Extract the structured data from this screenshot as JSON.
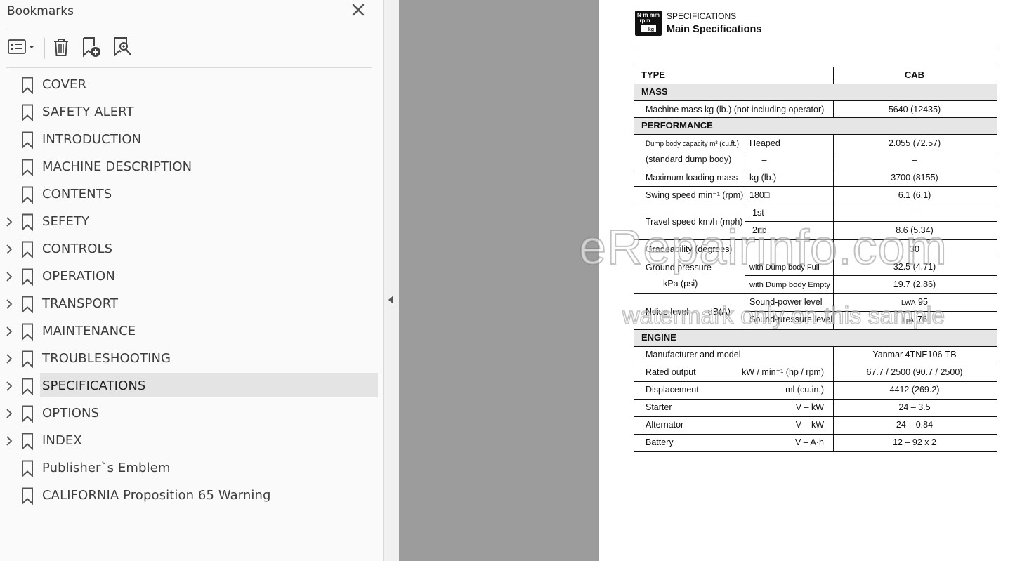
{
  "panel": {
    "title": "Bookmarks",
    "close_icon": "close-icon",
    "toolbar": [
      {
        "name": "options-menu-button",
        "icon": "list-options-icon"
      },
      {
        "name": "delete-bookmark-button",
        "icon": "trash-icon"
      },
      {
        "name": "new-bookmark-button",
        "icon": "bookmark-add-icon"
      },
      {
        "name": "find-bookmark-button",
        "icon": "bookmark-search-icon"
      }
    ],
    "bookmarks": [
      {
        "label": "COVER",
        "expandable": false
      },
      {
        "label": "SAFETY ALERT",
        "expandable": false
      },
      {
        "label": "INTRODUCTION",
        "expandable": false
      },
      {
        "label": "MACHINE DESCRIPTION",
        "expandable": false
      },
      {
        "label": "CONTENTS",
        "expandable": false
      },
      {
        "label": "SEFETY",
        "expandable": true
      },
      {
        "label": "CONTROLS",
        "expandable": true
      },
      {
        "label": "OPERATION",
        "expandable": true
      },
      {
        "label": "TRANSPORT",
        "expandable": true
      },
      {
        "label": "MAINTENANCE",
        "expandable": true
      },
      {
        "label": "TROUBLESHOOTING",
        "expandable": true
      },
      {
        "label": "SPECIFICATIONS",
        "expandable": true,
        "selected": true
      },
      {
        "label": "OPTIONS",
        "expandable": true
      },
      {
        "label": "INDEX",
        "expandable": true
      },
      {
        "label": "Publisher`s Emblem",
        "expandable": false
      },
      {
        "label": "CALIFORNIA Proposition 65 Warning",
        "expandable": false
      }
    ]
  },
  "doc": {
    "icon_text": {
      "line1": "N·m mm",
      "line2": "rpm",
      "line3": "kg"
    },
    "section_label": "SPECIFICATIONS",
    "section_title": "Main Specifications",
    "table": {
      "type_label": "TYPE",
      "type_value": "CAB",
      "mass_header": "MASS",
      "machine_mass_label": "Machine mass  kg (lb.) (not including operator)",
      "machine_mass_value": "5640 (12435)",
      "performance_header": "PERFORMANCE",
      "dump_label_1": "Dump body capacity m³ (cu.ft.)",
      "dump_label_2": "(standard dump body)",
      "dump_sub_1": "Heaped",
      "dump_val_1": "2.055 (72.57)",
      "dump_sub_2": "–",
      "dump_val_2": "–",
      "max_load_label": "Maximum loading mass",
      "max_load_unit": "kg (lb.)",
      "max_load_value": "3700 (8155)",
      "swing_label": "Swing speed  min⁻¹ (rpm)",
      "swing_sub": "180□",
      "swing_value": "6.1 (6.1)",
      "travel_label": "Travel speed km/h (mph)",
      "travel_sub_1": "1st",
      "travel_val_1": "–",
      "travel_sub_2": "2nd",
      "travel_val_2": "8.6 (5.34)",
      "grade_label": "Gradeability (degrees)",
      "grade_value": "30",
      "ground_label_1": "Ground pressure",
      "ground_label_2": "kPa (psi)",
      "ground_sub_1": "with Dump body Full",
      "ground_val_1": "32.5 (4.71)",
      "ground_sub_2": "with Dump body Empty",
      "ground_val_2": "19.7 (2.86)",
      "noise_label": "Noise level        dB(A)",
      "noise_sub_1": "Sound-power level",
      "noise_val_1_sym": "LWA",
      "noise_val_1": "95",
      "noise_sub_2": "Sound-pressure level",
      "noise_val_2_sym": "LpA",
      "noise_val_2": "76",
      "engine_header": "ENGINE",
      "engine_rows": [
        {
          "label": "Manufacturer and model",
          "unit": "",
          "value": "Yanmar 4TNE106-TB"
        },
        {
          "label": "Rated output",
          "unit": "kW / min⁻¹ (hp / rpm)",
          "value": "67.7 / 2500 (90.7 / 2500)"
        },
        {
          "label": "Displacement",
          "unit": "ml (cu.in.)",
          "value": "4412 (269.2)"
        },
        {
          "label": "Starter",
          "unit": "V – kW",
          "value": "24 – 3.5"
        },
        {
          "label": "Alternator",
          "unit": "V – kW",
          "value": "24 – 0.84"
        },
        {
          "label": "Battery",
          "unit": "V – A·h",
          "value": "12 – 92 x 2"
        }
      ]
    },
    "watermark_line1": "eRepairinfo.com",
    "watermark_line2": "watermark only on this sample"
  }
}
